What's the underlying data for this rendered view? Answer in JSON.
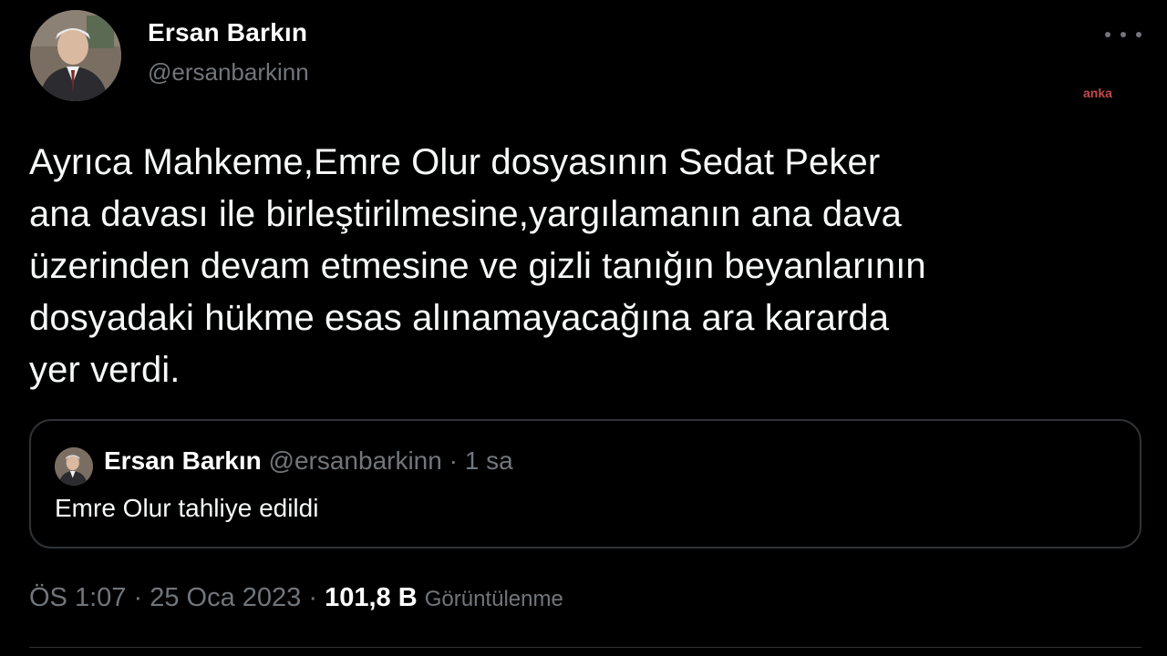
{
  "author": {
    "name": "Ersan Barkın",
    "handle": "@ersanbarkinn"
  },
  "watermark": "anka",
  "tweet": {
    "lines": [
      "Ayrıca Mahkeme,Emre Olur dosyasının Sedat Peker",
      "ana davası ile birleştirilmesine,yargılamanın ana dava",
      "üzerinden devam etmesine ve gizli tanığın beyanlarının",
      "dosyadaki hükme esas alınamayacağına ara kararda",
      "yer verdi."
    ]
  },
  "quote": {
    "name": "Ersan Barkın",
    "handle": "@ersanbarkinn",
    "separator": "·",
    "time": "1 sa",
    "text": "Emre Olur tahliye edildi"
  },
  "meta": {
    "time": "ÖS 1:07",
    "separator": "·",
    "date": "25 Oca 2023",
    "views_count": "101,8 B",
    "views_label": "Görüntülenme"
  },
  "icons": {
    "more": "more-horizontal-icon"
  }
}
